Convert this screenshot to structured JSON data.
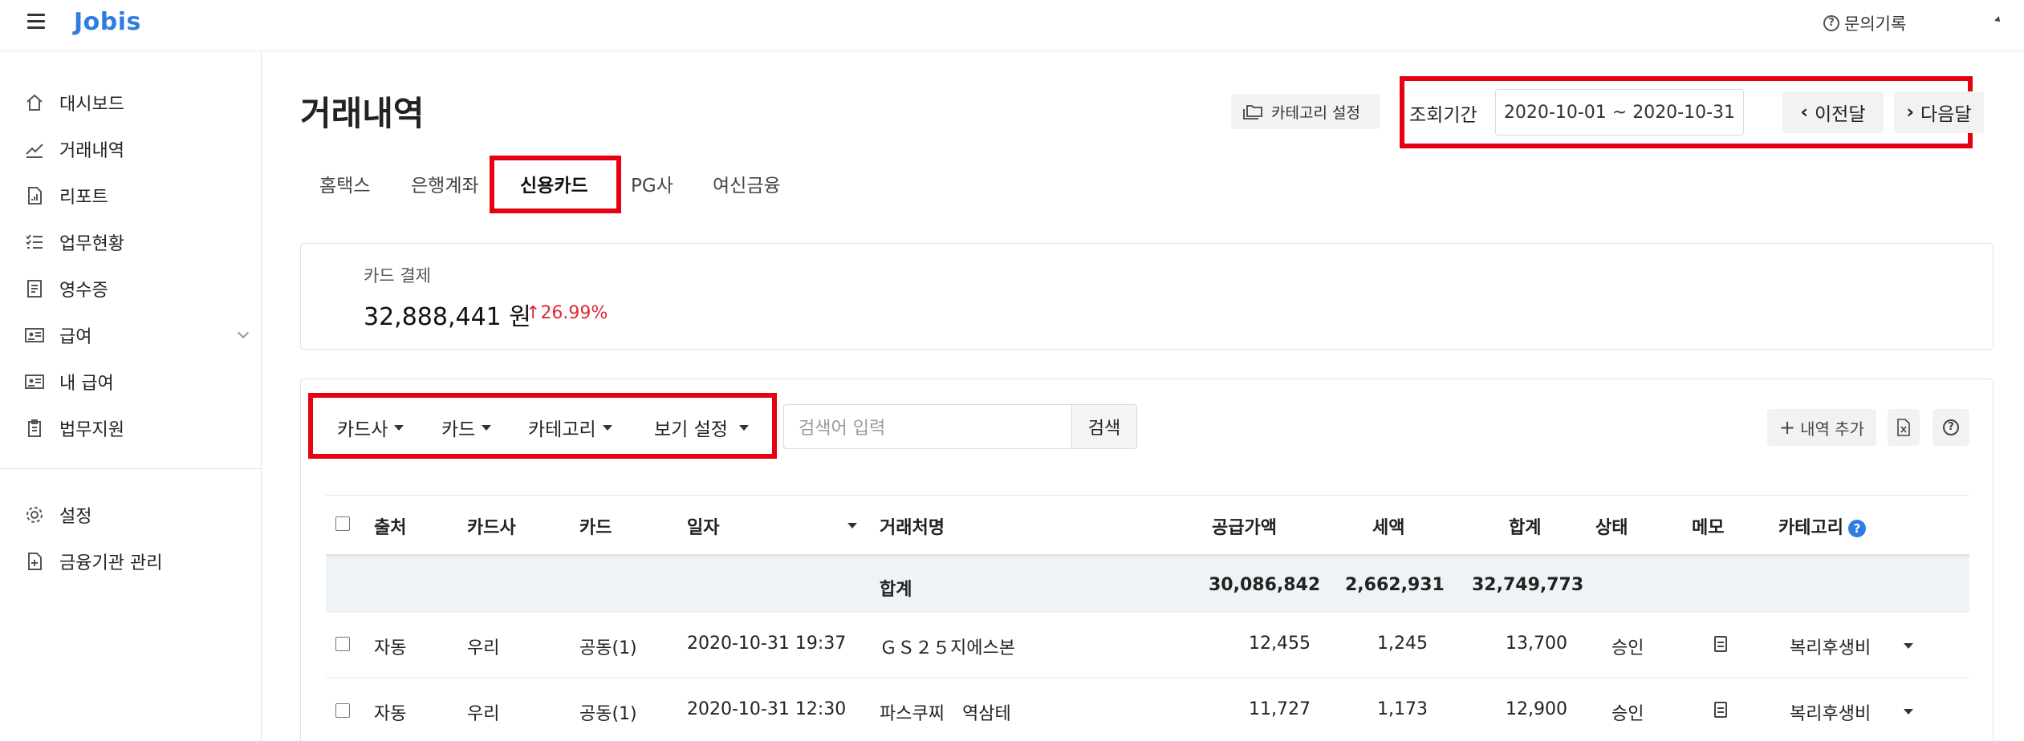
{
  "header": {
    "logo": "Jobis",
    "inquiry": "문의기록"
  },
  "sidebar": {
    "items": [
      {
        "label": "대시보드",
        "icon": "home-icon"
      },
      {
        "label": "거래내역",
        "icon": "trend-icon"
      },
      {
        "label": "리포트",
        "icon": "report-icon"
      },
      {
        "label": "업무현황",
        "icon": "checklist-icon"
      },
      {
        "label": "영수증",
        "icon": "receipt-icon"
      },
      {
        "label": "급여",
        "icon": "id-card-icon"
      },
      {
        "label": "내 급여",
        "icon": "id-card-icon"
      },
      {
        "label": "법무지원",
        "icon": "clipboard-icon"
      }
    ],
    "bottom_items": [
      {
        "label": "설정",
        "icon": "gear-icon"
      },
      {
        "label": "금융기관 관리",
        "icon": "file-add-icon"
      }
    ]
  },
  "main": {
    "title": "거래내역",
    "category_setting": "카테고리 설정",
    "period_label": "조회기간",
    "period_value": "2020-10-01 ~ 2020-10-31",
    "prev_month": "이전달",
    "next_month": "다음달",
    "tabs": [
      "홈택스",
      "은행계좌",
      "신용카드",
      "PG사",
      "여신금융"
    ],
    "active_tab": "신용카드"
  },
  "summary": {
    "label": "카드 결제",
    "amount": "32,888,441 원",
    "change": "26.99%",
    "change_color": "#e0283a"
  },
  "filters": {
    "card_company": "카드사",
    "card": "카드",
    "category": "카테고리",
    "view_settings": "보기 설정",
    "search_placeholder": "검색어 입력",
    "search_button": "검색",
    "add_entry": "내역 추가"
  },
  "table": {
    "headers": [
      "출처",
      "카드사",
      "카드",
      "일자",
      "거래처명",
      "공급가액",
      "세액",
      "합계",
      "상태",
      "메모",
      "카테고리"
    ],
    "total": {
      "label": "합계",
      "supply": "30,086,842",
      "tax": "2,662,931",
      "sum": "32,749,773"
    },
    "rows": [
      {
        "source": "자동",
        "company": "우리",
        "card": "공동(1)",
        "date": "2020-10-31 19:37",
        "merchant": "ＧＳ２５지에스본",
        "supply": "12,455",
        "tax": "1,245",
        "sum": "13,700",
        "status": "승인",
        "category": "복리후생비"
      },
      {
        "source": "자동",
        "company": "우리",
        "card": "공동(1)",
        "date": "2020-10-31 12:30",
        "merchant": "파스쿠찌　역삼테",
        "supply": "11,727",
        "tax": "1,173",
        "sum": "12,900",
        "status": "승인",
        "category": "복리후생비"
      }
    ]
  },
  "colors": {
    "brand": "#2f7de1",
    "highlight": "#e60012"
  }
}
